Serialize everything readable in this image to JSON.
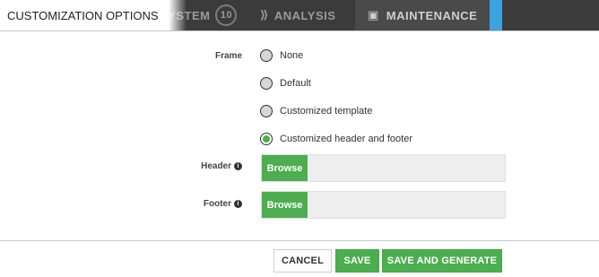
{
  "background_app": {
    "tabs": [
      {
        "label": "SYSTEM",
        "badge": "10"
      },
      {
        "label": "ANALYSIS"
      },
      {
        "label": "MAINTENANCE"
      }
    ]
  },
  "modal": {
    "title": "CUSTOMIZATION OPTIONS",
    "frame": {
      "label": "Frame",
      "options": [
        {
          "label": "None",
          "selected": false
        },
        {
          "label": "Default",
          "selected": false
        },
        {
          "label": "Customized template",
          "selected": false
        },
        {
          "label": "Customized header and footer",
          "selected": true
        }
      ]
    },
    "header_field": {
      "label": "Header",
      "button": "Browse",
      "value": ""
    },
    "footer_field": {
      "label": "Footer",
      "button": "Browse",
      "value": ""
    },
    "actions": {
      "cancel": "CANCEL",
      "save": "SAVE",
      "save_generate": "SAVE AND GENERATE"
    }
  },
  "colors": {
    "accent_green": "#4cae4f",
    "field_bg": "#eeeeee",
    "app_bar": "#3b3b3b"
  }
}
